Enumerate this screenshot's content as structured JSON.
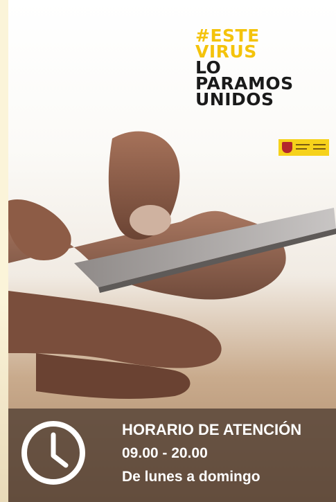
{
  "campaign": {
    "line1": "#ESTE",
    "line2": "VIRUS",
    "line3": "LO",
    "line4": "PARAMOS",
    "line5": "UNIDOS"
  },
  "hours": {
    "title": "HORARIO DE ATENCIÓN",
    "time": "09.00 - 20.00",
    "days": "De lunes a domingo"
  },
  "icons": {
    "clock": "clock-icon",
    "government": "government-logo"
  },
  "colors": {
    "accent_yellow": "#f4c30b",
    "band": "#503e32",
    "text_dark": "#1a1a1a"
  }
}
